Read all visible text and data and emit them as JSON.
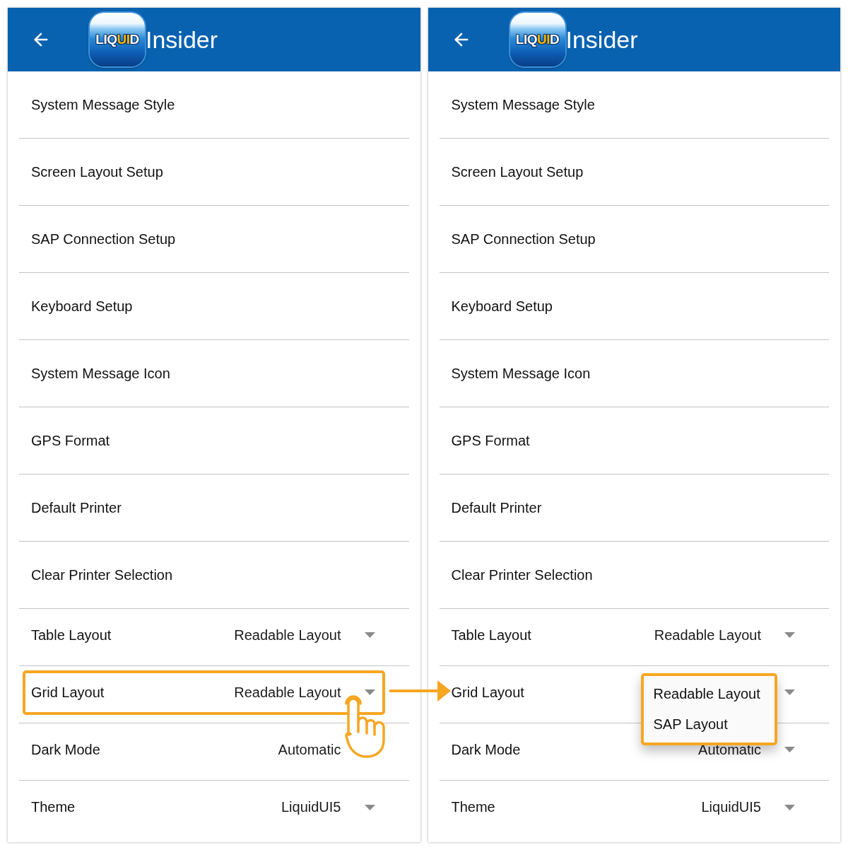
{
  "panels": [
    {
      "header": {
        "logo": {
          "parts": [
            {
              "text": "LIQ",
              "color": "#ffffff"
            },
            {
              "text": "UI",
              "color": "#f7b500"
            },
            {
              "text": "D",
              "color": "#ffffff"
            }
          ]
        },
        "title": "Insider"
      },
      "settings": [
        {
          "kind": "link",
          "label": "System Message Style"
        },
        {
          "kind": "link",
          "label": "Screen Layout Setup"
        },
        {
          "kind": "link",
          "label": "SAP Connection Setup"
        },
        {
          "kind": "link",
          "label": "Keyboard Setup"
        },
        {
          "kind": "link",
          "label": "System Message Icon"
        },
        {
          "kind": "link",
          "label": "GPS Format"
        },
        {
          "kind": "link",
          "label": "Default Printer"
        },
        {
          "kind": "link",
          "label": "Clear Printer Selection"
        },
        {
          "kind": "dropdown",
          "label": "Table Layout",
          "value": "Readable Layout"
        },
        {
          "kind": "dropdown",
          "label": "Grid Layout",
          "value": "Readable Layout",
          "tapped": true,
          "highlighted": true
        },
        {
          "kind": "dropdown",
          "label": "Dark Mode",
          "value": "Automatic",
          "caret": false
        },
        {
          "kind": "dropdown",
          "label": "Theme",
          "value": "LiquidUI5"
        }
      ]
    },
    {
      "header": {
        "logo": {
          "parts": [
            {
              "text": "LIQ",
              "color": "#ffffff"
            },
            {
              "text": "UI",
              "color": "#f7b500"
            },
            {
              "text": "D",
              "color": "#ffffff"
            }
          ]
        },
        "title": "Insider"
      },
      "settings": [
        {
          "kind": "link",
          "label": "System Message Style"
        },
        {
          "kind": "link",
          "label": "Screen Layout Setup"
        },
        {
          "kind": "link",
          "label": "SAP Connection Setup"
        },
        {
          "kind": "link",
          "label": "Keyboard Setup"
        },
        {
          "kind": "link",
          "label": "System Message Icon"
        },
        {
          "kind": "link",
          "label": "GPS Format"
        },
        {
          "kind": "link",
          "label": "Default Printer"
        },
        {
          "kind": "link",
          "label": "Clear Printer Selection"
        },
        {
          "kind": "dropdown",
          "label": "Table Layout",
          "value": "Readable Layout"
        },
        {
          "kind": "dropdown",
          "label": "Grid Layout",
          "menu": {
            "highlighted": true,
            "options": [
              "Readable Layout",
              "SAP Layout"
            ]
          }
        },
        {
          "kind": "dropdown",
          "label": "Dark Mode",
          "value": "Automatic"
        },
        {
          "kind": "dropdown",
          "label": "Theme",
          "value": "LiquidUI5"
        }
      ]
    }
  ],
  "annotation_arrow": true
}
